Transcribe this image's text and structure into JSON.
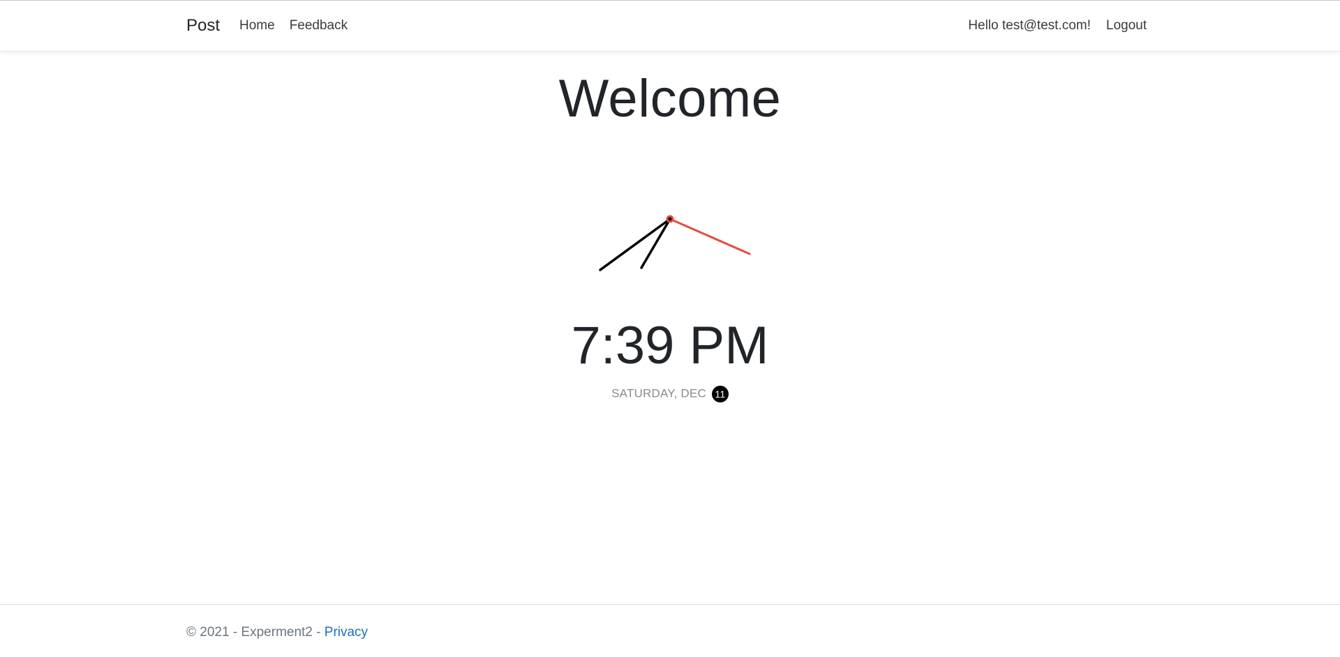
{
  "nav": {
    "brand": "Post",
    "links": [
      {
        "label": "Home"
      },
      {
        "label": "Feedback"
      }
    ],
    "greeting": "Hello test@test.com!",
    "logout": "Logout"
  },
  "main": {
    "heading": "Welcome",
    "time": "7:39 PM",
    "date_text": "SATURDAY, DEC",
    "day": "11",
    "clock": {
      "hour_hand_color": "#000000",
      "minute_hand_color": "#000000",
      "second_hand_color": "#e74c3c"
    }
  },
  "footer": {
    "copyright": "© 2021 - Experment2 -",
    "privacy_label": "Privacy"
  },
  "colors": {
    "link": "#1b6ec2",
    "text": "#212529",
    "muted": "#6c757d"
  }
}
